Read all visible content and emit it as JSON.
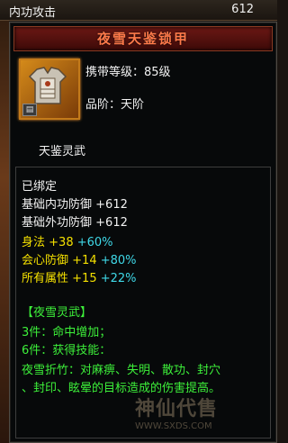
{
  "topbar": {
    "label": "内功攻击",
    "value": "612"
  },
  "item": {
    "name": "夜雪天鉴锁甲",
    "level_line": "携带等级：85级",
    "grade_line": "品阶：天阶",
    "category": "天鉴灵武",
    "icon": "armor-icon",
    "bound": "已绑定",
    "base_stats": [
      {
        "name": "基础内功防御",
        "value": "+612"
      },
      {
        "name": "基础外功防御",
        "value": "+612"
      }
    ],
    "extra_stats": [
      {
        "name": "身法",
        "value": "+38",
        "bonus": "+60%"
      },
      {
        "name": "会心防御",
        "value": "+14",
        "bonus": "+80%"
      },
      {
        "name": "所有属性",
        "value": "+15",
        "bonus": "+22%"
      }
    ],
    "set": {
      "title": "【夜雪灵武】",
      "line3": "3件：命中增加；",
      "line6": "6件：获得技能：",
      "desc1": "夜雪折竹：对麻痹、失明、散功、封穴",
      "desc2": "、封印、眩晕的目标造成的伤害提高。"
    }
  },
  "watermark": {
    "text": "神仙代售",
    "url": "WWW.SXDS.COM"
  },
  "colors": {
    "title": "#ff7a4a",
    "stat_yellow": "#f4e000",
    "bonus_cyan": "#3fd9e8",
    "set_green": "#3df03a"
  }
}
